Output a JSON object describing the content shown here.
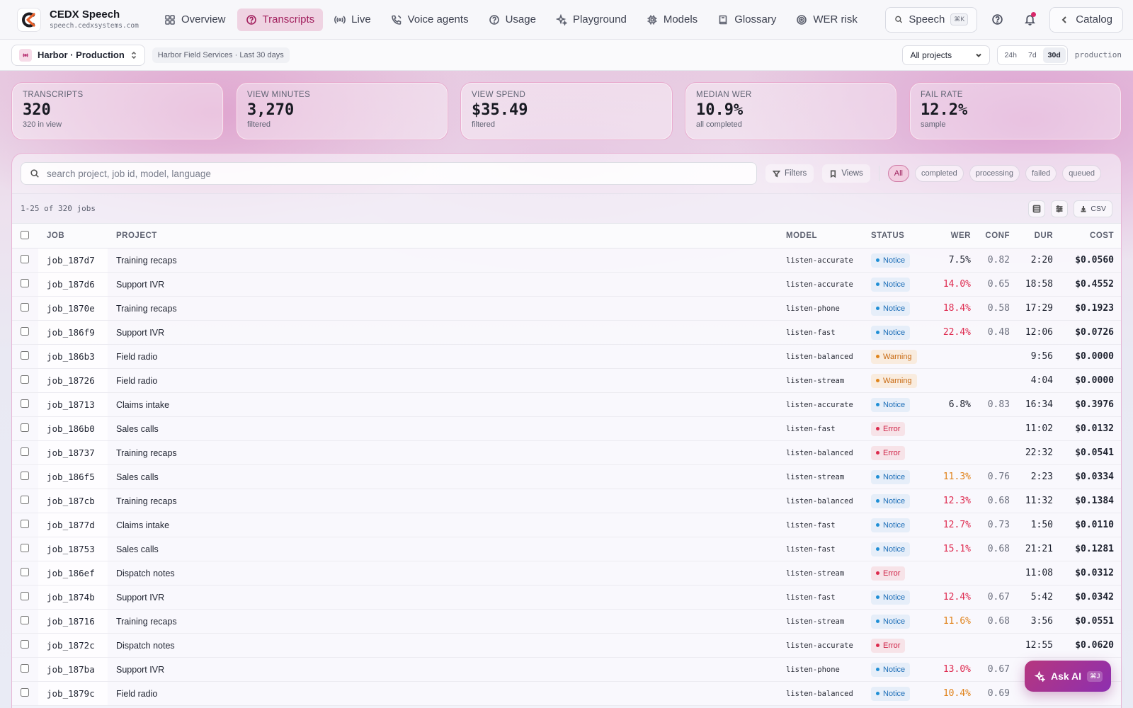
{
  "app": {
    "name": "CEDX Speech",
    "url": "speech.cedxsystems.com"
  },
  "nav": [
    {
      "id": "overview",
      "label": "Overview",
      "icon": "grid-icon"
    },
    {
      "id": "transcripts",
      "label": "Transcripts",
      "icon": "help-circle-icon",
      "active": true
    },
    {
      "id": "live",
      "label": "Live",
      "icon": "broadcast-icon"
    },
    {
      "id": "voice-agents",
      "label": "Voice agents",
      "icon": "phone-icon"
    },
    {
      "id": "usage",
      "label": "Usage",
      "icon": "help-circle-icon"
    },
    {
      "id": "playground",
      "label": "Playground",
      "icon": "sparkle-icon"
    },
    {
      "id": "models",
      "label": "Models",
      "icon": "chip-icon"
    },
    {
      "id": "glossary",
      "label": "Glossary",
      "icon": "book-icon"
    },
    {
      "id": "wer-risk",
      "label": "WER risk",
      "icon": "target-icon"
    }
  ],
  "topbar": {
    "search_label": "Speech",
    "search_kbd": "⌘K",
    "catalog_label": "Catalog"
  },
  "subbar": {
    "environment": "Harbor · Production",
    "context": "Harbor Field Services · Last 30 days",
    "project_filter": "All projects",
    "ranges": [
      "24h",
      "7d",
      "30d"
    ],
    "active_range": "30d",
    "env_tag": "production"
  },
  "kpis": [
    {
      "label": "Transcripts",
      "value": "320",
      "sub": "320 in view"
    },
    {
      "label": "View minutes",
      "value": "3,270",
      "sub": "filtered"
    },
    {
      "label": "View spend",
      "value": "$35.49",
      "sub": "filtered"
    },
    {
      "label": "Median WER",
      "value": "10.9%",
      "sub": "all completed"
    },
    {
      "label": "Fail rate",
      "value": "12.2%",
      "sub": "sample"
    }
  ],
  "toolbar": {
    "search_placeholder": "search project, job id, model, language",
    "filters_label": "Filters",
    "views_label": "Views",
    "status_chips": [
      "All",
      "completed",
      "processing",
      "failed",
      "queued"
    ],
    "active_chip": "All"
  },
  "meta": {
    "count_text": "1-25 of 320 jobs",
    "csv_label": "CSV"
  },
  "columns": {
    "job": "JOB",
    "project": "PROJECT",
    "model": "MODEL",
    "status": "STATUS",
    "wer": "WER",
    "conf": "CONF",
    "dur": "DUR",
    "cost": "COST"
  },
  "rows": [
    {
      "job": "job_187d7",
      "project": "Training recaps",
      "model": "listen-accurate",
      "status": "Notice",
      "wer": "7.5%",
      "wer_level": "normal",
      "conf": "0.82",
      "dur": "2:20",
      "cost": "$0.0560"
    },
    {
      "job": "job_187d6",
      "project": "Support IVR",
      "model": "listen-accurate",
      "status": "Notice",
      "wer": "14.0%",
      "wer_level": "bad",
      "conf": "0.65",
      "dur": "18:58",
      "cost": "$0.4552"
    },
    {
      "job": "job_1870e",
      "project": "Training recaps",
      "model": "listen-phone",
      "status": "Notice",
      "wer": "18.4%",
      "wer_level": "bad",
      "conf": "0.58",
      "dur": "17:29",
      "cost": "$0.1923"
    },
    {
      "job": "job_186f9",
      "project": "Support IVR",
      "model": "listen-fast",
      "status": "Notice",
      "wer": "22.4%",
      "wer_level": "bad",
      "conf": "0.48",
      "dur": "12:06",
      "cost": "$0.0726"
    },
    {
      "job": "job_186b3",
      "project": "Field radio",
      "model": "listen-balanced",
      "status": "Warning",
      "wer": "",
      "wer_level": "normal",
      "conf": "",
      "dur": "9:56",
      "cost": "$0.0000"
    },
    {
      "job": "job_18726",
      "project": "Field radio",
      "model": "listen-stream",
      "status": "Warning",
      "wer": "",
      "wer_level": "normal",
      "conf": "",
      "dur": "4:04",
      "cost": "$0.0000"
    },
    {
      "job": "job_18713",
      "project": "Claims intake",
      "model": "listen-accurate",
      "status": "Notice",
      "wer": "6.8%",
      "wer_level": "normal",
      "conf": "0.83",
      "dur": "16:34",
      "cost": "$0.3976"
    },
    {
      "job": "job_186b0",
      "project": "Sales calls",
      "model": "listen-fast",
      "status": "Error",
      "wer": "",
      "wer_level": "normal",
      "conf": "",
      "dur": "11:02",
      "cost": "$0.0132"
    },
    {
      "job": "job_18737",
      "project": "Training recaps",
      "model": "listen-balanced",
      "status": "Error",
      "wer": "",
      "wer_level": "normal",
      "conf": "",
      "dur": "22:32",
      "cost": "$0.0541"
    },
    {
      "job": "job_186f5",
      "project": "Sales calls",
      "model": "listen-stream",
      "status": "Notice",
      "wer": "11.3%",
      "wer_level": "warn",
      "conf": "0.76",
      "dur": "2:23",
      "cost": "$0.0334"
    },
    {
      "job": "job_187cb",
      "project": "Training recaps",
      "model": "listen-balanced",
      "status": "Notice",
      "wer": "12.3%",
      "wer_level": "bad",
      "conf": "0.68",
      "dur": "11:32",
      "cost": "$0.1384"
    },
    {
      "job": "job_1877d",
      "project": "Claims intake",
      "model": "listen-fast",
      "status": "Notice",
      "wer": "12.7%",
      "wer_level": "bad",
      "conf": "0.73",
      "dur": "1:50",
      "cost": "$0.0110"
    },
    {
      "job": "job_18753",
      "project": "Sales calls",
      "model": "listen-fast",
      "status": "Notice",
      "wer": "15.1%",
      "wer_level": "bad",
      "conf": "0.68",
      "dur": "21:21",
      "cost": "$0.1281"
    },
    {
      "job": "job_186ef",
      "project": "Dispatch notes",
      "model": "listen-stream",
      "status": "Error",
      "wer": "",
      "wer_level": "normal",
      "conf": "",
      "dur": "11:08",
      "cost": "$0.0312"
    },
    {
      "job": "job_1874b",
      "project": "Support IVR",
      "model": "listen-fast",
      "status": "Notice",
      "wer": "12.4%",
      "wer_level": "bad",
      "conf": "0.67",
      "dur": "5:42",
      "cost": "$0.0342"
    },
    {
      "job": "job_18716",
      "project": "Training recaps",
      "model": "listen-stream",
      "status": "Notice",
      "wer": "11.6%",
      "wer_level": "warn",
      "conf": "0.68",
      "dur": "3:56",
      "cost": "$0.0551"
    },
    {
      "job": "job_1872c",
      "project": "Dispatch notes",
      "model": "listen-accurate",
      "status": "Error",
      "wer": "",
      "wer_level": "normal",
      "conf": "",
      "dur": "12:55",
      "cost": "$0.0620"
    },
    {
      "job": "job_187ba",
      "project": "Support IVR",
      "model": "listen-phone",
      "status": "Notice",
      "wer": "13.0%",
      "wer_level": "bad",
      "conf": "0.67",
      "dur": "",
      "cost": ""
    },
    {
      "job": "job_1879c",
      "project": "Field radio",
      "model": "listen-balanced",
      "status": "Notice",
      "wer": "10.4%",
      "wer_level": "warn",
      "conf": "0.69",
      "dur": "",
      "cost": ""
    }
  ],
  "ask_ai": {
    "label": "Ask AI",
    "kbd": "⌘J"
  },
  "colors": {
    "accent": "#b3246a",
    "notice": "#1f6fb8",
    "warning": "#c86a12",
    "error": "#cf2347"
  }
}
